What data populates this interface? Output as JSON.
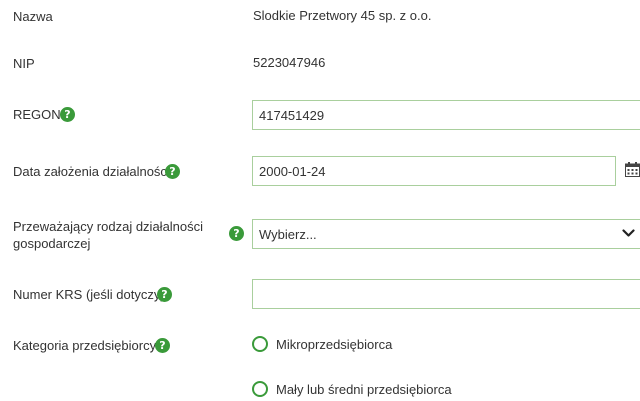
{
  "fields": {
    "nazwa": {
      "label": "Nazwa",
      "value": "Slodkie Przetwory 45 sp. z o.o."
    },
    "nip": {
      "label": "NIP",
      "value": "5223047946"
    },
    "regon": {
      "label": "REGON",
      "value": "417451429"
    },
    "data_zalozenia": {
      "label": "Data założenia działalności",
      "value": "2000-01-24"
    },
    "rodzaj_dzialalnosci": {
      "label_line1": "Przeważający rodzaj działalności",
      "label_line2": "gospodarczej",
      "selected": "Wybierz..."
    },
    "numer_krs": {
      "label": "Numer KRS (jeśli dotyczy)",
      "value": ""
    },
    "kategoria": {
      "label": "Kategoria przedsiębiorcy",
      "options": [
        "Mikroprzedsiębiorca",
        "Mały lub średni przedsiębiorca"
      ]
    }
  },
  "help_glyph": "?",
  "icons": {
    "help": "help-icon",
    "calendar": "calendar-icon",
    "dropdown": "chevron-down-icon"
  },
  "colors": {
    "accent": "#3a9a3a",
    "input_border": "#a9cf9d",
    "text": "#333333"
  }
}
